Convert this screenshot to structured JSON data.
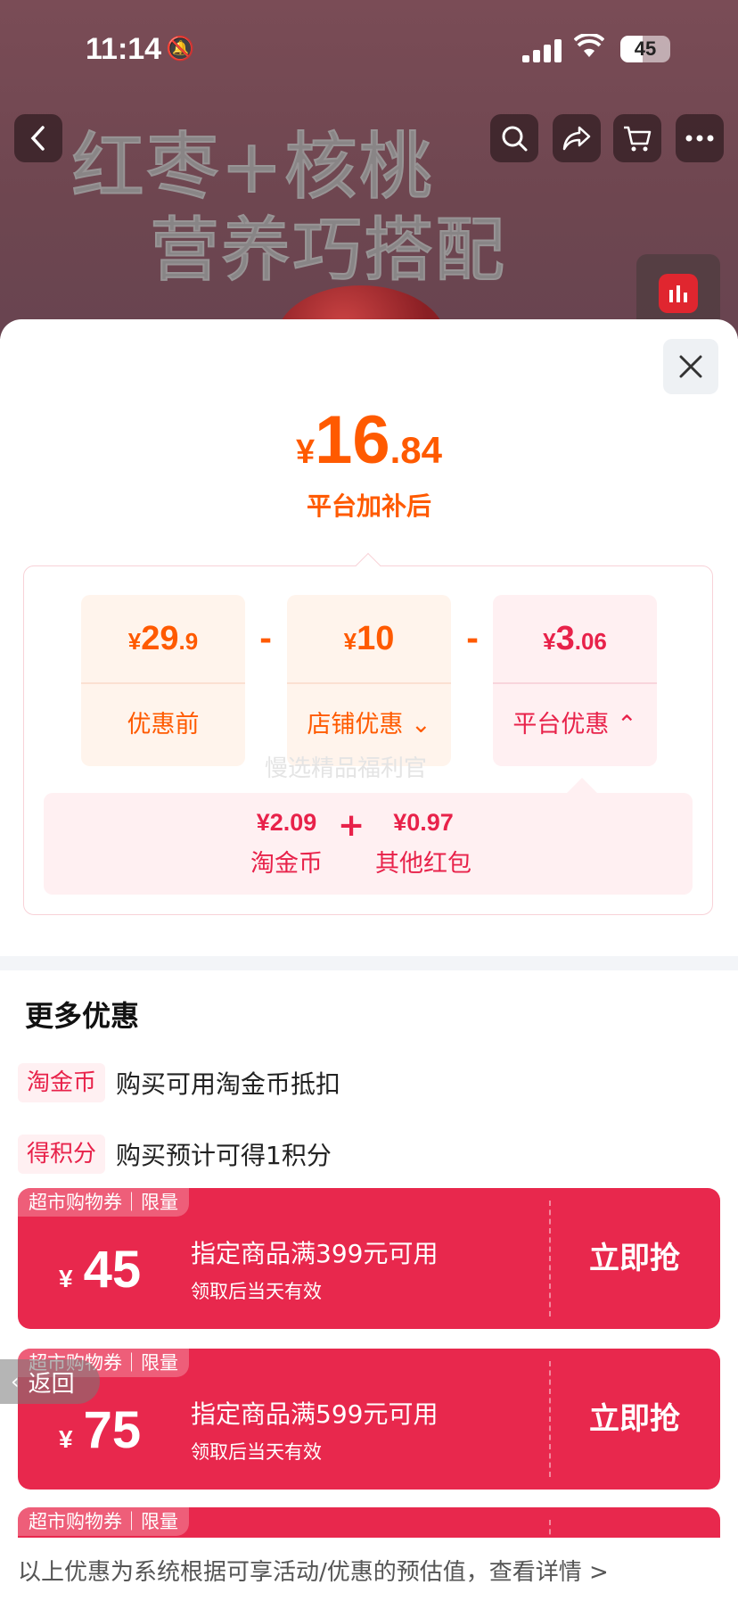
{
  "status_bar": {
    "time": "11:14",
    "battery": "45",
    "battery_level": 0.45,
    "bell_icon": "bell-slash-icon",
    "wifi_icon": "wifi-icon",
    "signal_icon": "signal-icon"
  },
  "product_banner": {
    "line1": "红枣+核桃",
    "line2": "营养巧搭配",
    "nav_icons": [
      "back-icon",
      "search-icon",
      "share-icon",
      "cart-icon",
      "more-icon"
    ]
  },
  "sheet": {
    "close_icon": "close-icon",
    "final_price": {
      "currency": "¥",
      "integer": "16",
      "decimal": ".84"
    },
    "final_caption": "平台加补后",
    "breakdown": {
      "cards": [
        {
          "currency": "¥",
          "integer": "29",
          "decimal": ".9",
          "label": "优惠前",
          "arrow": ""
        },
        {
          "currency": "¥",
          "integer": "10",
          "decimal": "",
          "label": "店铺优惠",
          "arrow": "⌄"
        },
        {
          "currency": "¥",
          "integer": "3",
          "decimal": ".06",
          "label": "平台优惠",
          "arrow": "⌃"
        }
      ],
      "operator": "-",
      "platform_detail": {
        "items": [
          {
            "value": "¥2.09",
            "label": "淘金币"
          },
          {
            "value": "¥0.97",
            "label": "其他红包"
          }
        ],
        "plus": "+"
      },
      "watermark": "慢选精品福利官"
    },
    "more": {
      "title": "更多优惠",
      "perks": [
        {
          "tag": "淘金币",
          "desc": "购买可用淘金币抵扣"
        },
        {
          "tag": "得积分",
          "desc": "购买预计可得1积分"
        }
      ],
      "coupons": [
        {
          "tag": "超市购物券｜限量",
          "currency": "¥",
          "amount": "45",
          "condition": "指定商品满399元可用",
          "validity": "领取后当天有效",
          "button": "立即抢"
        },
        {
          "tag": "超市购物券｜限量",
          "currency": "¥",
          "amount": "75",
          "condition": "指定商品满599元可用",
          "validity": "领取后当天有效",
          "button": "立即抢"
        },
        {
          "tag": "超市购物券｜限量",
          "currency": "",
          "amount": "",
          "condition": "",
          "validity": "",
          "button": ""
        }
      ]
    },
    "footer_note": "以上优惠为系统根据可享活动/优惠的预估值，查看详情 >",
    "back_float": {
      "chevron": "‹",
      "label": "返回"
    }
  },
  "colors": {
    "accent_orange": "#ff5a00",
    "accent_red": "#e8224a",
    "coupon_red": "#e8284d"
  }
}
